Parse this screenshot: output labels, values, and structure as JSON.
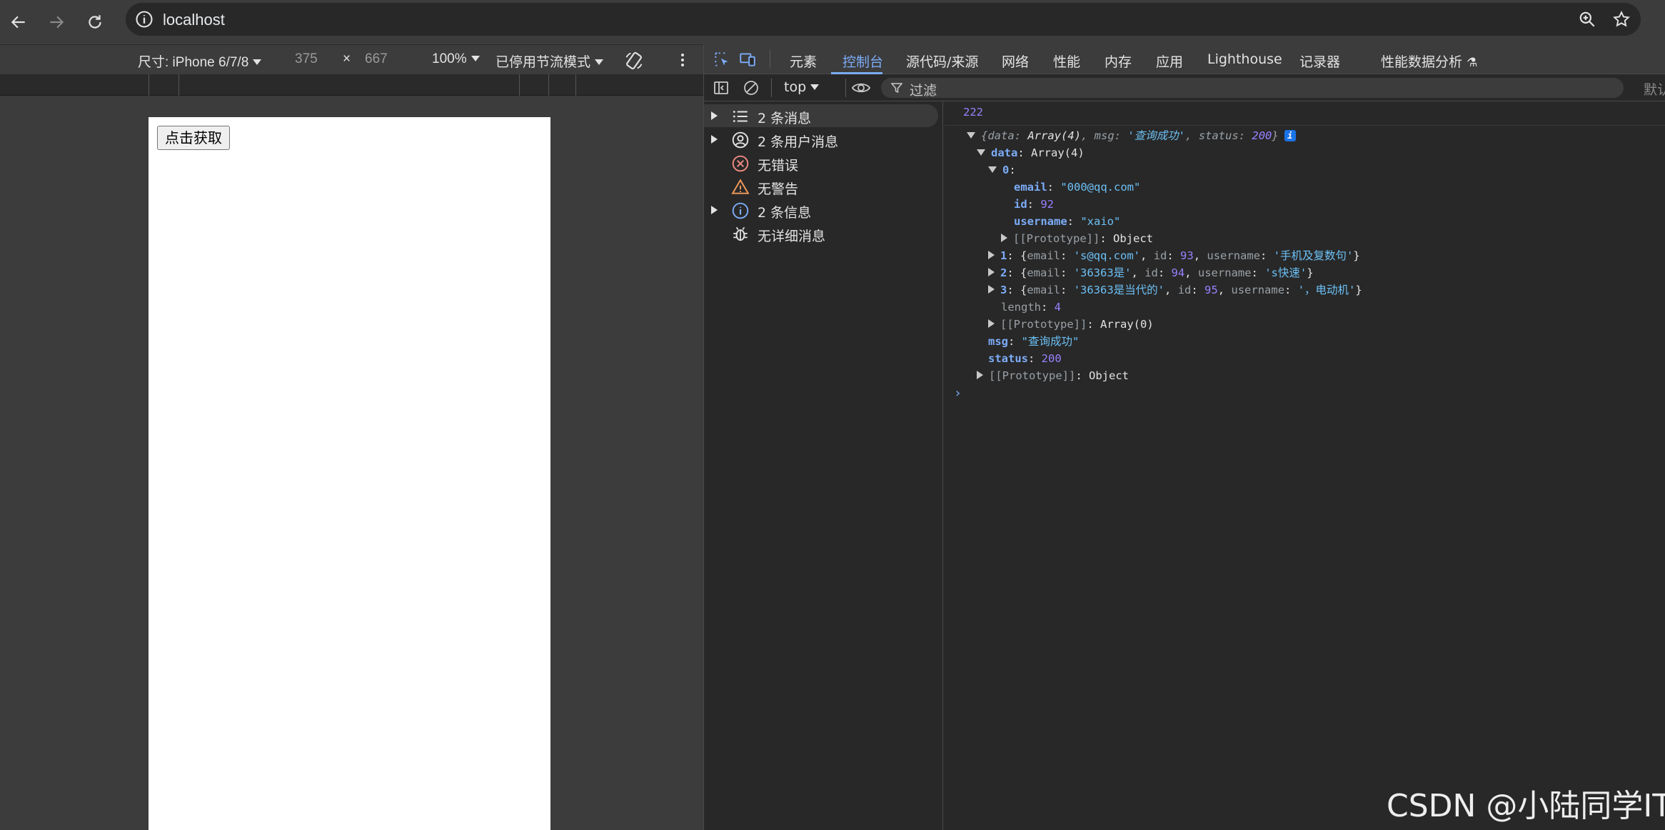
{
  "browser": {
    "url": "localhost"
  },
  "device_toolbar": {
    "device_label": "尺寸: iPhone 6/7/8",
    "width": "375",
    "times": "×",
    "height": "667",
    "zoom": "100%",
    "throttle": "已停用节流模式"
  },
  "page": {
    "fetch_button": "点击获取"
  },
  "devtools": {
    "tabs": [
      "元素",
      "控制台",
      "源代码/来源",
      "网络",
      "性能",
      "内存",
      "应用",
      "Lighthouse",
      "记录器",
      "性能数据分析"
    ],
    "active_tab": "控制台",
    "context": "top",
    "filter_placeholder": "过滤",
    "default_levels": "默认"
  },
  "sidebar": {
    "items": [
      {
        "label": "2 条消息",
        "icon": "list-icon"
      },
      {
        "label": "2 条用户消息",
        "icon": "user-icon"
      },
      {
        "label": "无错误",
        "icon": "error-icon"
      },
      {
        "label": "无警告",
        "icon": "warning-icon"
      },
      {
        "label": "2 条信息",
        "icon": "info-icon"
      },
      {
        "label": "无详细消息",
        "icon": "bug-icon"
      }
    ]
  },
  "console": {
    "log_value": "222",
    "summary": {
      "k_data": "data",
      "v_data": "Array(4)",
      "k_msg": "msg",
      "v_msg": "'查询成功'",
      "k_status": "status",
      "v_status": "200"
    },
    "data_key": "data",
    "data_type": "Array(4)",
    "item0_key": "0",
    "email_key": "email",
    "email_val": "\"000@qq.com\"",
    "id_key": "id",
    "id_val": "92",
    "username_key": "username",
    "username_val": "\"xaio\"",
    "proto_key": "[[Prototype]]",
    "proto_obj": "Object",
    "rows": [
      {
        "index": "1",
        "email": "'s@qq.com'",
        "id": "93",
        "username": "'手机及复数句'"
      },
      {
        "index": "2",
        "email": "'36363是'",
        "id": "94",
        "username": "'s快速'"
      },
      {
        "index": "3",
        "email": "'36363是当代的'",
        "id": "95",
        "username": "'，电动机'"
      }
    ],
    "length_key": "length",
    "length_val": "4",
    "proto_arr": "Array(0)",
    "msg_key": "msg",
    "msg_val": "\"查询成功\"",
    "status_key": "status",
    "status_val": "200"
  },
  "watermark": "CSDN @小陆同学IT"
}
